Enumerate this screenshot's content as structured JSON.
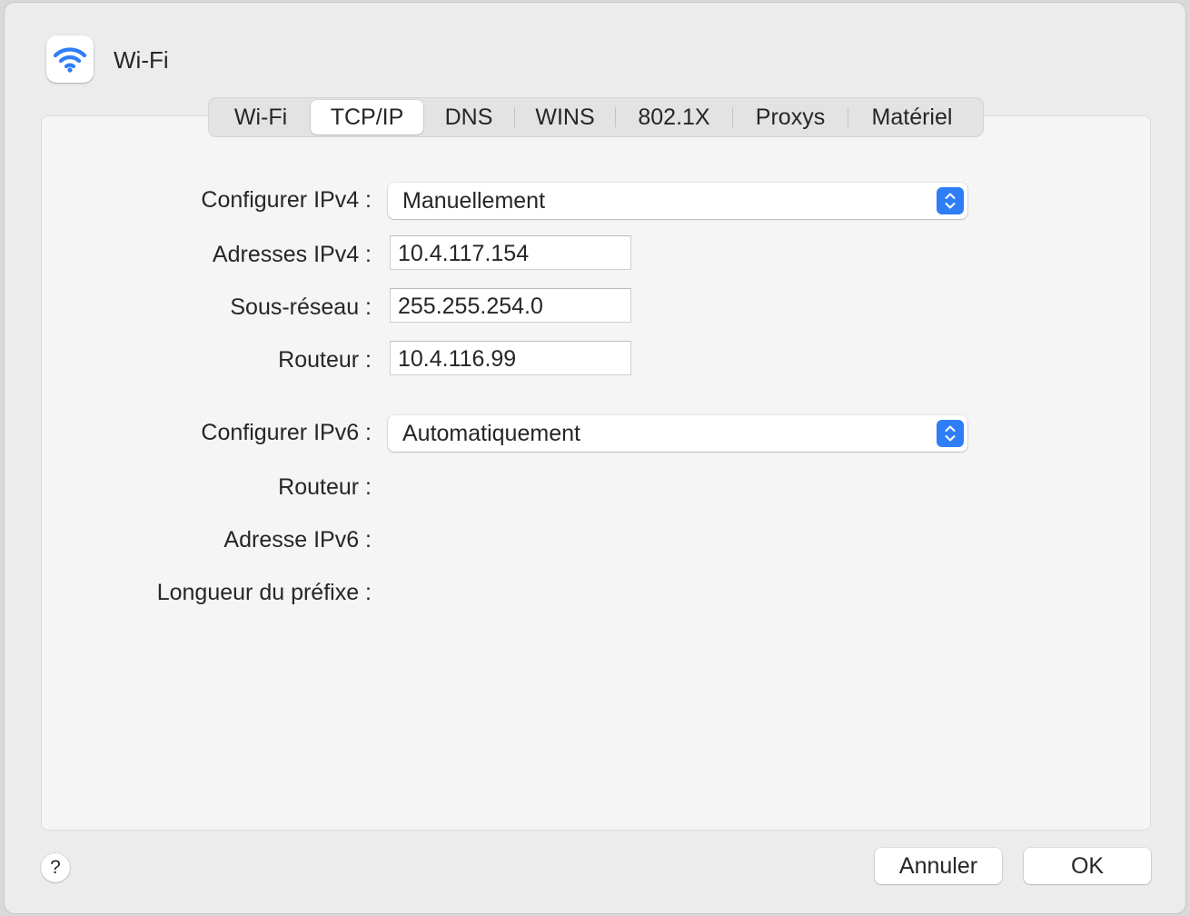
{
  "header": {
    "title": "Wi-Fi",
    "icon": "wifi-icon",
    "icon_color": "#2f7ef5"
  },
  "tabs": [
    {
      "label": "Wi-Fi",
      "selected": false
    },
    {
      "label": "TCP/IP",
      "selected": true
    },
    {
      "label": "DNS",
      "selected": false
    },
    {
      "label": "WINS",
      "selected": false
    },
    {
      "label": "802.1X",
      "selected": false
    },
    {
      "label": "Proxys",
      "selected": false
    },
    {
      "label": "Matériel",
      "selected": false
    }
  ],
  "ipv4": {
    "configure_label": "Configurer IPv4 :",
    "configure_value": "Manuellement",
    "address_label": "Adresses IPv4 :",
    "address_value": "10.4.117.154",
    "subnet_label": "Sous-réseau :",
    "subnet_value": "255.255.254.0",
    "router_label": "Routeur :",
    "router_value": "10.4.116.99"
  },
  "ipv6": {
    "configure_label": "Configurer IPv6 :",
    "configure_value": "Automatiquement",
    "router_label": "Routeur :",
    "address_label": "Adresse IPv6 :",
    "prefix_label": "Longueur du préfixe :"
  },
  "footer": {
    "help_label": "?",
    "cancel_label": "Annuler",
    "ok_label": "OK"
  },
  "colors": {
    "accent": "#2f7ef5",
    "window_bg": "#ececec",
    "panel_bg": "#f5f5f5"
  }
}
